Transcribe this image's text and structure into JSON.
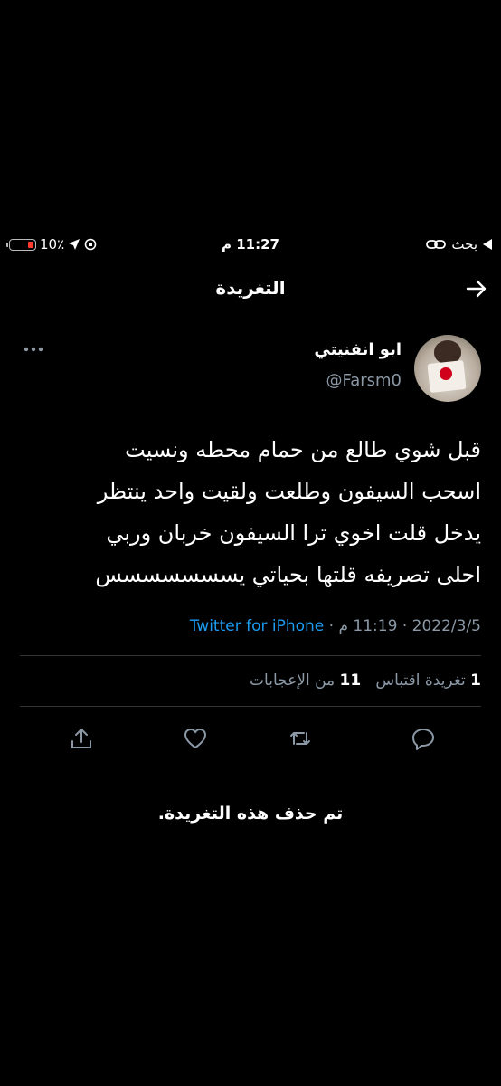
{
  "status_bar": {
    "battery_text": "10٪",
    "battery_level": 0.1,
    "time": "11:27 م",
    "carrier_label": "بحث"
  },
  "header": {
    "title": "التغريدة"
  },
  "tweet": {
    "display_name": "ابو انفنيتي",
    "handle": "@Farsm0",
    "text": "قبل شوي طالع من حمام محطه ونسيت\nاسحب السيفون وطلعت ولقيت واحد ينتظر\nيدخل قلت اخوي ترا السيفون خربان وربي\nاحلى تصريفه قلتها بحياتي يسسسسسسس",
    "date": "2022/3/5",
    "time": "11:19 م",
    "separator": "·",
    "source": "Twitter for iPhone",
    "retweets_count": "1",
    "retweets_label": "تغريدة",
    "quotes_label": "اقتباس",
    "likes_count": "11",
    "likes_label": "من الإعجابات"
  },
  "deleted_notice": "تم حذف هذه التغريدة."
}
